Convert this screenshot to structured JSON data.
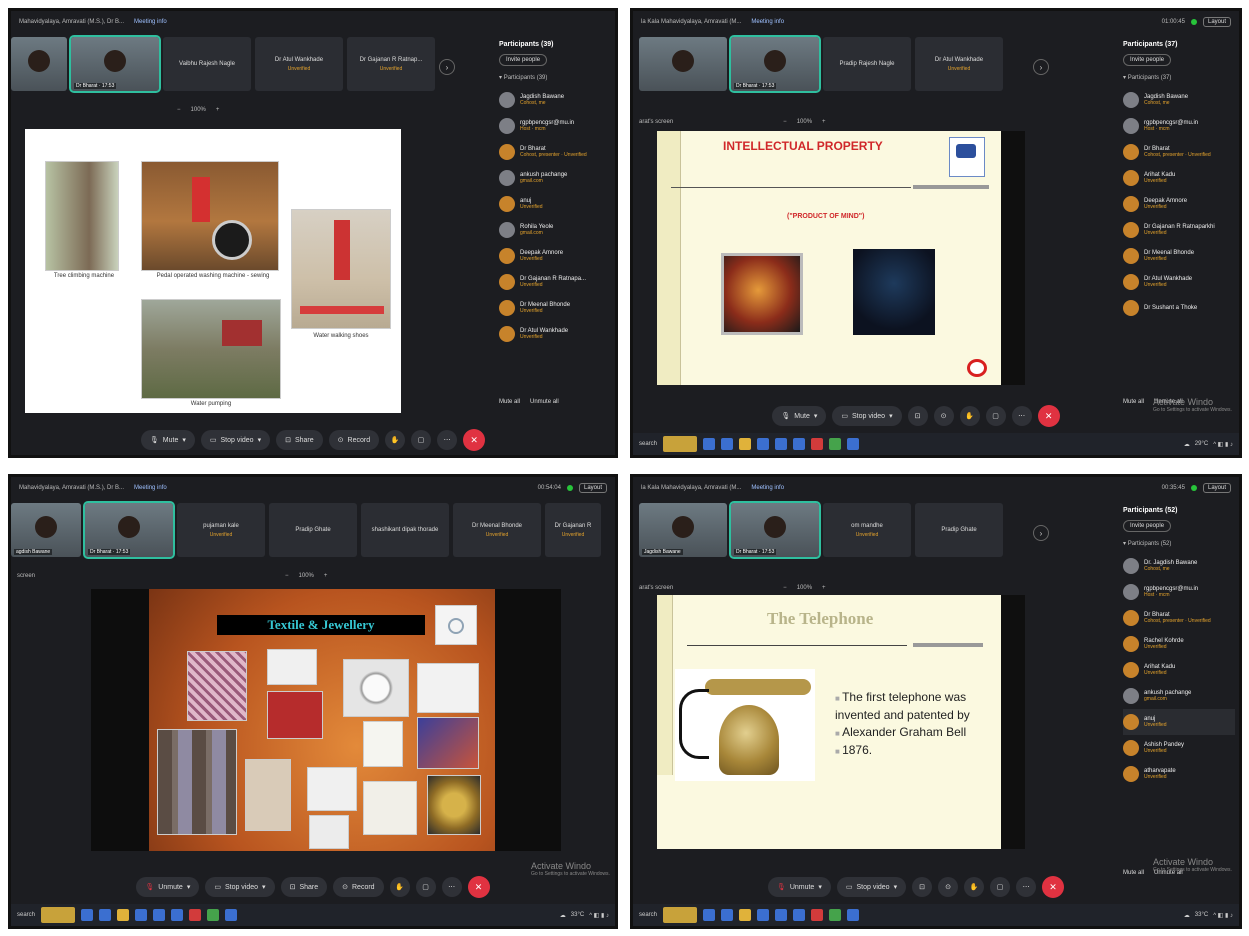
{
  "q1": {
    "topbar": {
      "title": "Mahavidyalaya, Amravati (M.S.), Dr B...",
      "info": "Meeting info"
    },
    "tiles": [
      {
        "label": "Dr Bharat · 17:53",
        "status": ""
      },
      {
        "label": "Vaibhu Rajesh Nagle",
        "status": ""
      },
      {
        "label": "Dr Atul Wankhade",
        "status": "Unverified"
      },
      {
        "label": "Dr Gajanan R Ratnap...",
        "status": "Unverified"
      }
    ],
    "zoom": "100%",
    "captions": [
      "Tree climbing machine",
      "Pedal operated washing machine - sewing",
      "Water walking shoes",
      "Water pumping"
    ],
    "panel": {
      "title": "Participants (39)",
      "invite": "Invite people",
      "subheader": "Participants (39)",
      "people": [
        {
          "name": "Jagdish Bawane",
          "sub": "Cohost, me"
        },
        {
          "name": "rgpbpencgsr@mu.in",
          "sub": "Host · mcm"
        },
        {
          "name": "Dr Bharat",
          "sub": "Cohost, presenter · Unverified"
        },
        {
          "name": "ankush pachange",
          "sub": "gmail.com"
        },
        {
          "name": "anuj",
          "sub": "Unverified"
        },
        {
          "name": "Rohila Yeole",
          "sub": "gmail.com"
        },
        {
          "name": "Deepak Amnore",
          "sub": "Unverified"
        },
        {
          "name": "Dr Gajanan R Ratnapa...",
          "sub": "Unverified"
        },
        {
          "name": "Dr Meenal Bhonde",
          "sub": "Unverified"
        },
        {
          "name": "Dr Atul Wankhade",
          "sub": "Unverified"
        }
      ],
      "mute_all": "Mute all",
      "unmute_all": "Unmute all"
    },
    "controls": {
      "mute": "Mute",
      "video": "Stop video",
      "share": "Share",
      "record": "Record"
    }
  },
  "q2": {
    "topbar": {
      "title": "la Kala Mahavidyalaya, Amravati (M...",
      "info": "Meeting info",
      "time": "01:00:45",
      "layout": "Layout"
    },
    "tiles": [
      {
        "label": "",
        "status": ""
      },
      {
        "label": "Dr Bharat · 17:53",
        "status": ""
      },
      {
        "label": "Pradip Rajesh Nagle",
        "status": ""
      },
      {
        "label": "Dr Atul Wankhade",
        "status": "Unverified"
      }
    ],
    "screen_label": "arat's screen",
    "zoom": "100%",
    "slide": {
      "title": "INTELLECTUAL PROPERTY",
      "subtitle": "(\"PRODUCT OF MIND\")"
    },
    "panel": {
      "title": "Participants (37)",
      "invite": "Invite people",
      "subheader": "Participants (37)",
      "people": [
        {
          "name": "Jagdish Bawane",
          "sub": "Cohost, me"
        },
        {
          "name": "rgpbpencgsr@mu.in",
          "sub": "Host · mcm"
        },
        {
          "name": "Dr Bharat",
          "sub": "Cohost, presenter · Unverified"
        },
        {
          "name": "Arihat Kadu",
          "sub": "Unverified"
        },
        {
          "name": "Deepak Amnore",
          "sub": "Unverified"
        },
        {
          "name": "Dr Gajanan R Ratnaparkhi",
          "sub": "Unverified"
        },
        {
          "name": "Dr Meenal Bhonde",
          "sub": "Unverified"
        },
        {
          "name": "Dr Atul Wankhade",
          "sub": "Unverified"
        },
        {
          "name": "Dr Sushant a Thoke",
          "sub": ""
        }
      ],
      "mute_all": "Mute all",
      "unmute_all": "Unmute all"
    },
    "controls": {
      "mute": "Mute",
      "video": "Stop video"
    },
    "activate": {
      "title": "Activate Windo",
      "sub": "Go to Settings to activate Windows."
    },
    "taskbar": {
      "search": "search",
      "temp": "29°C"
    }
  },
  "q3": {
    "topbar": {
      "title": "Mahavidyalaya, Amravati (M.S.), Dr B...",
      "info": "Meeting info",
      "time": "00:54:04",
      "layout": "Layout"
    },
    "tiles": [
      {
        "label": "agdish Bawane",
        "status": ""
      },
      {
        "label": "Dr Bharat · 17:53",
        "status": ""
      },
      {
        "label": "pujaman kale",
        "status": "Unverified"
      },
      {
        "label": "Pradip Ghate",
        "status": ""
      },
      {
        "label": "shashikant dipak thorade",
        "status": ""
      },
      {
        "label": "Dr Meenal Bhonde",
        "status": "Unverified"
      },
      {
        "label": "Dr Gajanan R",
        "status": "Unverified"
      }
    ],
    "screen_label": "screen",
    "zoom": "100%",
    "slide": {
      "title": "Textile & Jewellery"
    },
    "controls": {
      "mute": "Unmute",
      "video": "Stop video",
      "share": "Share",
      "record": "Record"
    },
    "activate": {
      "title": "Activate Windo",
      "sub": "Go to Settings to activate Windows."
    },
    "taskbar": {
      "search": "search",
      "temp": "33°C"
    }
  },
  "q4": {
    "topbar": {
      "title": "la Kala Mahavidyalaya, Amravati (M...",
      "info": "Meeting info",
      "time": "00:35:45",
      "layout": "Layout"
    },
    "tiles": [
      {
        "label": "Jagdish Bawane",
        "status": ""
      },
      {
        "label": "Dr Bharat · 17:53",
        "status": ""
      },
      {
        "label": "om mandhe",
        "status": "Unverified"
      },
      {
        "label": "Pradip Ghate",
        "status": ""
      }
    ],
    "screen_label": "arat's screen",
    "zoom": "100%",
    "slide": {
      "title": "The Telephone",
      "bullets": [
        "The first telephone was invented and patented by",
        "Alexander Graham Bell",
        "1876."
      ]
    },
    "panel": {
      "title": "Participants (52)",
      "invite": "Invite people",
      "subheader": "Participants (52)",
      "people": [
        {
          "name": "Dr. Jagdish Bawane",
          "sub": "Cohost, me"
        },
        {
          "name": "rgpbpencgsr@mu.in",
          "sub": "Host · mcm"
        },
        {
          "name": "Dr Bharat",
          "sub": "Cohost, presenter · Unverified"
        },
        {
          "name": "Rachel Kohrde",
          "sub": "Unverified"
        },
        {
          "name": "Arihat Kadu",
          "sub": "Unverified"
        },
        {
          "name": "ankush pachange",
          "sub": "gmail.com"
        },
        {
          "name": "anuj",
          "sub": "Unverified"
        },
        {
          "name": "Ashish Pandey",
          "sub": "Unverified"
        },
        {
          "name": "atharvapate",
          "sub": "Unverified"
        }
      ],
      "mute_all": "Mute all",
      "unmute_all": "Unmute all"
    },
    "controls": {
      "mute": "Unmute",
      "video": "Stop video"
    },
    "activate": {
      "title": "Activate Windo",
      "sub": "Go to Settings to activate Windows."
    },
    "taskbar": {
      "search": "search",
      "temp": "33°C"
    }
  },
  "colors": {
    "end_call": "#e03241",
    "active_speaker": "#2fbf9f",
    "unverified": "#e3a22c",
    "slide_cream": "#fbf9e0",
    "slide_orange": "#c7622a"
  }
}
